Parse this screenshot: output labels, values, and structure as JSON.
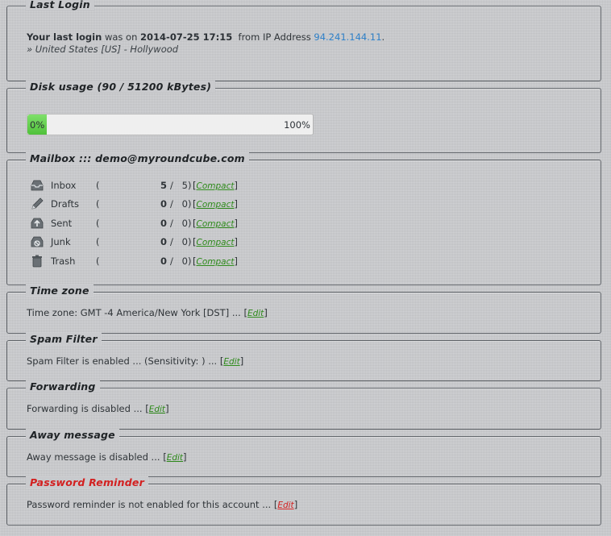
{
  "last_login": {
    "legend": "Last Login",
    "your_last_login": "Your last login",
    "was_on": "was on",
    "datetime": "2014-07-25 17:15",
    "from_ip": "from IP Address",
    "ip": "94.241.144.11",
    "period": ".",
    "location": "» United States [US] - Hollywood"
  },
  "disk_usage": {
    "legend": "Disk usage (90 / 51200 kBytes)",
    "start_label": "0%",
    "end_label": "100%",
    "percent_used": 0
  },
  "mailbox": {
    "legend": "Mailbox ::: demo@myroundcube.com",
    "compact_label": "Compact",
    "folders": [
      {
        "name": "Inbox",
        "icon": "inbox-icon",
        "count": "5",
        "total": "5"
      },
      {
        "name": "Drafts",
        "icon": "pencil-icon",
        "count": "0",
        "total": "0"
      },
      {
        "name": "Sent",
        "icon": "sent-icon",
        "count": "0",
        "total": "0"
      },
      {
        "name": "Junk",
        "icon": "junk-icon",
        "count": "0",
        "total": "0"
      },
      {
        "name": "Trash",
        "icon": "trash-icon",
        "count": "0",
        "total": "0"
      }
    ]
  },
  "time_zone": {
    "legend": "Time zone",
    "text": "Time zone: GMT -4 America/New York [DST] ... ",
    "edit": "Edit"
  },
  "spam_filter": {
    "legend": "Spam Filter",
    "text": "Spam Filter is enabled ... (Sensitivity: ) ... ",
    "edit": "Edit"
  },
  "forwarding": {
    "legend": "Forwarding",
    "text": "Forwarding is disabled ... ",
    "edit": "Edit"
  },
  "away": {
    "legend": "Away message",
    "text": "Away message is disabled ... ",
    "edit": "Edit"
  },
  "password": {
    "legend": "Password Reminder",
    "text": "Password reminder is not enabled for this account ... ",
    "edit": "Edit"
  },
  "colors": {
    "link": "#2d7fc7",
    "edit_green": "#2e8a1b",
    "alert_red": "#d32020",
    "progress_green": "#5fcf48"
  }
}
